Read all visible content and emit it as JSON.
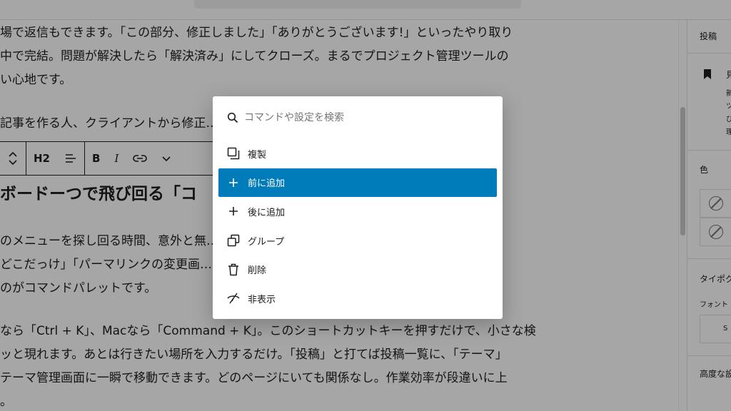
{
  "editor": {
    "para1": "場で返信もできます。「この部分、修正しました」「ありがとうございます!」といったやり取り\n中で完結。問題が解決したら「解決済み」にしてクローズ。まるでプロジェクト管理ツールの\nい心地です。",
    "para2": "記事を作る人、クライアントから修正……メディ",
    "heading": "ボードーつで飛び回る「コ",
    "para3": "のメニューを探し回る時間、意外と無……グインの\nどこだっけ」「パーマリンクの変更画……ら解放し\nのがコマンドパレットです。",
    "para4": "なら「Ctrl + K」、Macなら「Command + K」。このショートカットキーを押すだけで、小さな検\nッと現れます。あとは行きたい場所を入力するだけ。「投稿」と打てば投稿一覧に、「テーマ」\nテーマ管理画面に一瞬で移動できます。どのページにいても関係なし。作業効率が段違いに上\n。"
  },
  "block_toolbar": {
    "heading_level": "H2",
    "bold": "B",
    "italic": "I"
  },
  "sidebar": {
    "tab": "投稿",
    "item1": "見",
    "item1_lines": [
      "新",
      "ツ",
      "び",
      "理"
    ],
    "color_label": "色",
    "typography_label": "タイポグ",
    "font_label": "フォント",
    "size_label": "S",
    "advanced_label": "高度な設"
  },
  "palette": {
    "search_placeholder": "コマンドや設定を検索",
    "commands": [
      {
        "label": "複製",
        "icon": "duplicate-icon"
      },
      {
        "label": "前に追加",
        "icon": "plus-icon",
        "active": true
      },
      {
        "label": "後に追加",
        "icon": "plus-icon"
      },
      {
        "label": "グループ",
        "icon": "group-icon"
      },
      {
        "label": "削除",
        "icon": "trash-icon"
      },
      {
        "label": "非表示",
        "icon": "hide-icon"
      }
    ]
  },
  "colors": {
    "accent": "#007cba",
    "overlay": "rgba(0,0,0,0.35)"
  }
}
